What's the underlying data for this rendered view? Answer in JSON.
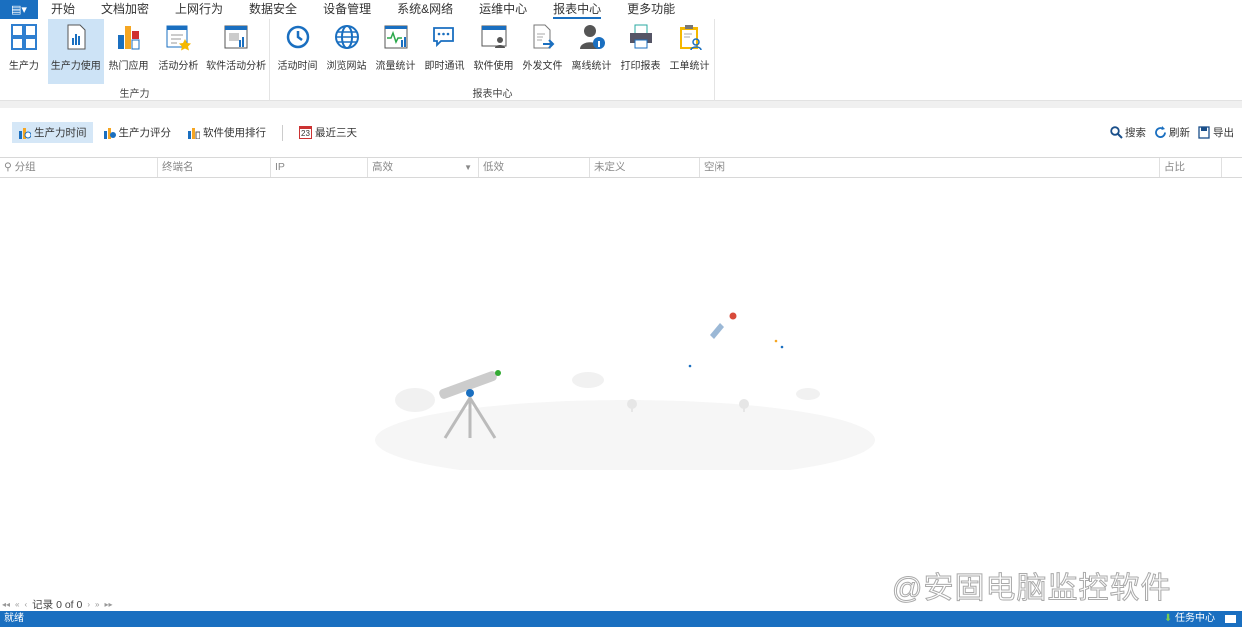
{
  "menu_tabs": [
    "开始",
    "文档加密",
    "上网行为",
    "数据安全",
    "设备管理",
    "系统&网络",
    "运维中心",
    "报表中心",
    "更多功能"
  ],
  "active_tab": "报表中心",
  "ribbon": {
    "groups": [
      {
        "label": "生产力",
        "buttons": [
          "生产力",
          "生产力使用",
          "热门应用",
          "活动分析",
          "软件活动分析"
        ]
      },
      {
        "label": "报表中心",
        "buttons": [
          "活动时间",
          "浏览网站",
          "流量统计",
          "即时通讯",
          "软件使用",
          "外发文件",
          "离线统计",
          "打印报表",
          "工单统计"
        ]
      }
    ],
    "selected": "生产力使用"
  },
  "toolbar": {
    "items": [
      "生产力时间",
      "生产力评分",
      "软件使用排行"
    ],
    "date_range": "最近三天",
    "calendar_day": "23",
    "search": "搜索",
    "refresh": "刷新",
    "export": "导出"
  },
  "grid": {
    "columns": [
      "分组",
      "终端名",
      "IP",
      "高效",
      "低效",
      "未定义",
      "空闲",
      "占比"
    ]
  },
  "pager": {
    "record_text": "记录 0 of 0"
  },
  "watermark": "@安固电脑监控软件",
  "status": {
    "text": "就绪",
    "task_center": "任务中心"
  },
  "colors": {
    "accent": "#1a6fc0",
    "selected": "#cde3f6"
  }
}
